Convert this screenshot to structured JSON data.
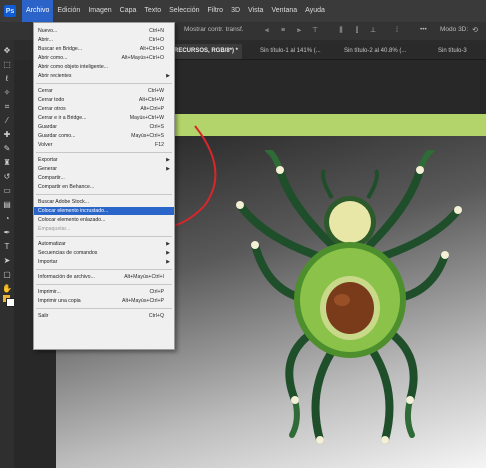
{
  "menubar": {
    "items": [
      {
        "label": "Archivo",
        "active": true
      },
      {
        "label": "Edición"
      },
      {
        "label": "Imagen"
      },
      {
        "label": "Capa"
      },
      {
        "label": "Texto"
      },
      {
        "label": "Selección"
      },
      {
        "label": "Filtro"
      },
      {
        "label": "3D"
      },
      {
        "label": "Vista"
      },
      {
        "label": "Ventana"
      },
      {
        "label": "Ayuda"
      }
    ]
  },
  "options": {
    "show_transform": "Mostrar contr. transf.",
    "more": "•••",
    "mode3d": "Modo 3D:"
  },
  "tabs": [
    {
      "label": "RECURSOS, RGB/8*) *",
      "active": true
    },
    {
      "label": "Sin título-1 al 141% (..."
    },
    {
      "label": "Sin título-2 al 40.8% (..."
    },
    {
      "label": "Sin título-3"
    }
  ],
  "file_menu": {
    "items": [
      {
        "label": "Nuevo...",
        "shortcut": "Ctrl+N"
      },
      {
        "label": "Abrir...",
        "shortcut": "Ctrl+O"
      },
      {
        "label": "Buscar en Bridge...",
        "shortcut": "Alt+Ctrl+O"
      },
      {
        "label": "Abrir como...",
        "shortcut": "Alt+Mayús+Ctrl+O"
      },
      {
        "label": "Abrir como objeto inteligente..."
      },
      {
        "label": "Abrir recientes",
        "submenu": true
      },
      {
        "label": "Cerrar",
        "shortcut": "Ctrl+W"
      },
      {
        "label": "Cerrar todo",
        "shortcut": "Alt+Ctrl+W"
      },
      {
        "label": "Cerrar otros",
        "shortcut": "Alt+Ctrl+P"
      },
      {
        "label": "Cerrar e ir a Bridge...",
        "shortcut": "Mayús+Ctrl+W"
      },
      {
        "label": "Guardar",
        "shortcut": "Ctrl+S"
      },
      {
        "label": "Guardar como...",
        "shortcut": "Mayús+Ctrl+S"
      },
      {
        "label": "Volver",
        "shortcut": "F12"
      },
      {
        "label": "Exportar",
        "submenu": true
      },
      {
        "label": "Generar",
        "submenu": true
      },
      {
        "label": "Compartir..."
      },
      {
        "label": "Compartir en Behance..."
      },
      {
        "label": "Buscar Adobe Stock..."
      },
      {
        "label": "Colocar elemento incrustado...",
        "highlighted": true
      },
      {
        "label": "Colocar elemento enlazado..."
      },
      {
        "label": "Empaquetar...",
        "disabled": true
      },
      {
        "label": "Automatizar",
        "submenu": true
      },
      {
        "label": "Secuencias de comandos",
        "submenu": true
      },
      {
        "label": "Importar",
        "submenu": true
      },
      {
        "label": "Información de archivo...",
        "shortcut": "Alt+Mayús+Ctrl+I"
      },
      {
        "label": "Imprimir...",
        "shortcut": "Ctrl+P"
      },
      {
        "label": "Imprimir una copia",
        "shortcut": "Alt+Mayús+Ctrl+P"
      },
      {
        "label": "Salir",
        "shortcut": "Ctrl+Q"
      }
    ]
  },
  "colors": {
    "accent": "#2a66c9",
    "band": "#b3d46b",
    "annotation": "#d8262b",
    "avocado": "#6cb33a",
    "pit": "#7a3b1a"
  },
  "icons": {
    "toolbar": [
      "move-icon",
      "marquee-icon",
      "lasso-icon",
      "magic-wand-icon",
      "crop-icon",
      "eyedropper-icon",
      "healing-icon",
      "brush-icon",
      "stamp-icon",
      "history-brush-icon",
      "eraser-icon",
      "gradient-icon",
      "blur-icon",
      "dodge-icon",
      "pen-icon",
      "type-icon",
      "path-select-icon",
      "shape-icon",
      "hand-icon",
      "zoom-icon"
    ]
  }
}
